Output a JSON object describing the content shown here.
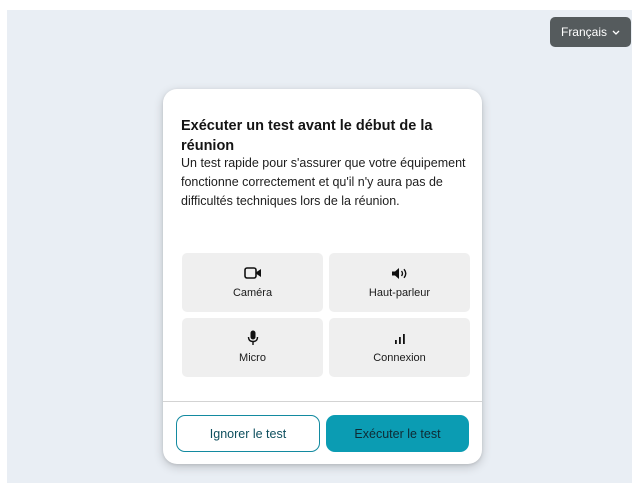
{
  "language": {
    "label": "Français"
  },
  "card": {
    "title": "Exécuter un test avant le début de la réunion",
    "description": "Un test rapide pour s'assurer que votre équipement fonctionne correctement et qu'il n'y aura pas de difficultés techniques lors de la réunion."
  },
  "tests": [
    {
      "label": "Caméra",
      "icon": "camera-icon"
    },
    {
      "label": "Haut-parleur",
      "icon": "speaker-icon"
    },
    {
      "label": "Micro",
      "icon": "microphone-icon"
    },
    {
      "label": "Connexion",
      "icon": "signal-icon"
    }
  ],
  "actions": {
    "skip_label": "Ignorer le test",
    "run_label": "Exécuter le test"
  },
  "colors": {
    "accent": "#0b9cb3",
    "background": "#e9eef4",
    "tile": "#efefef",
    "language_button": "#555b5d"
  }
}
